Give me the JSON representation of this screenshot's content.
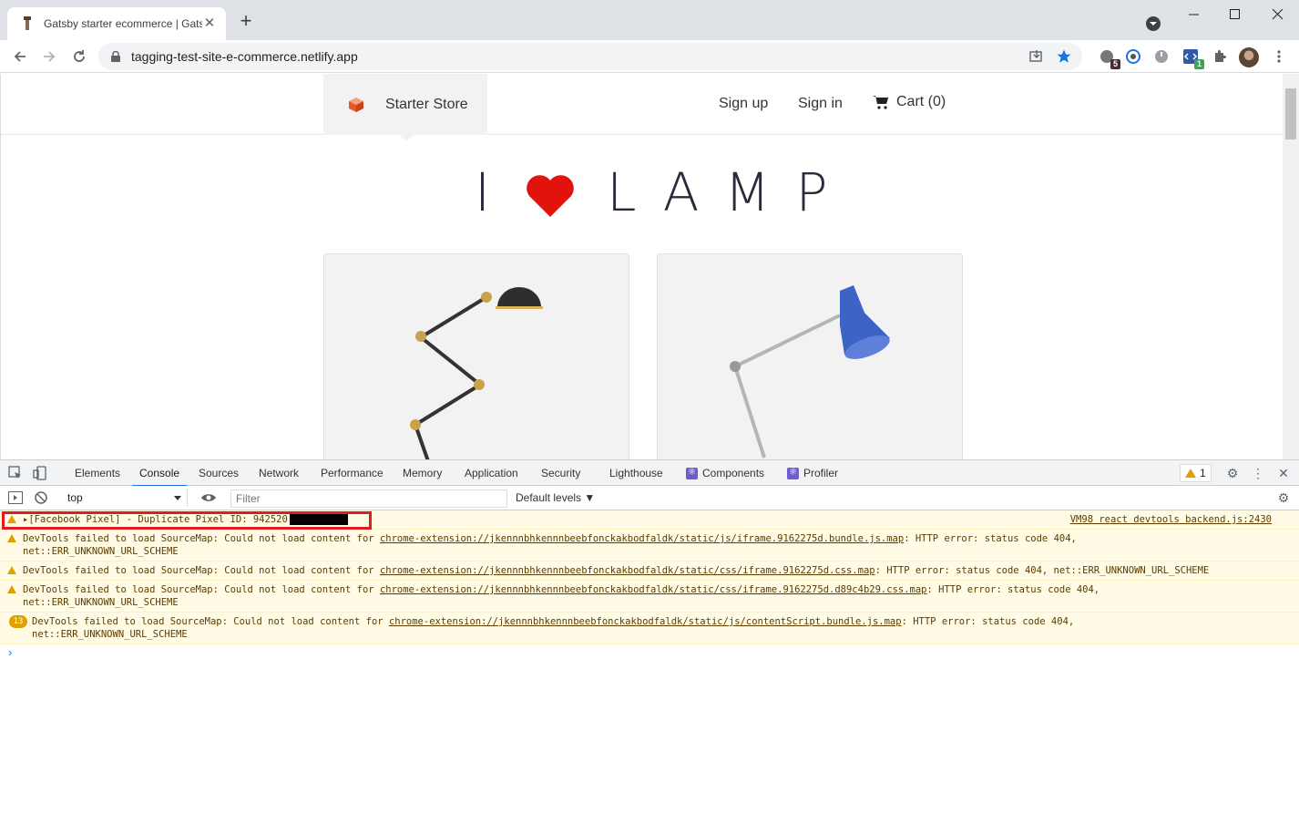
{
  "browser": {
    "tab_title": "Gatsby starter ecommerce | Gatsby",
    "url": "tagging-test-site-e-commerce.netlify.app",
    "extension_badges": [
      "5",
      "1"
    ]
  },
  "site": {
    "brand": "Starter Store",
    "nav": {
      "sign_up": "Sign up",
      "sign_in": "Sign in",
      "cart": "Cart (0)"
    },
    "hero": {
      "left": "I",
      "right": "LAMP"
    }
  },
  "devtools": {
    "tabs": [
      "Elements",
      "Console",
      "Sources",
      "Network",
      "Performance",
      "Memory",
      "Application",
      "Security",
      "Lighthouse",
      "Components",
      "Profiler"
    ],
    "active_tab": "Console",
    "warning_count": "1",
    "context": "top",
    "filter_placeholder": "Filter",
    "levels": "Default levels ▼",
    "messages": [
      {
        "text": "▸[Facebook Pixel] - Duplicate Pixel ID: 942520",
        "source": "VM98 react devtools backend.js:2430"
      },
      {
        "prefix": "DevTools failed to load SourceMap: Could not load content for ",
        "link": "chrome-extension://jkennnbhkennnbeebfonckakbodfaldk/static/js/iframe.9162275d.bundle.js.map",
        "suffix": ": HTTP error: status code 404,",
        "line2": "net::ERR_UNKNOWN_URL_SCHEME"
      },
      {
        "prefix": "DevTools failed to load SourceMap: Could not load content for ",
        "link": "chrome-extension://jkennnbhkennnbeebfonckakbodfaldk/static/css/iframe.9162275d.css.map",
        "suffix": ": HTTP error: status code 404, net::ERR_UNKNOWN_URL_SCHEME"
      },
      {
        "prefix": "DevTools failed to load SourceMap: Could not load content for ",
        "link": "chrome-extension://jkennnbhkennnbeebfonckakbodfaldk/static/css/iframe.9162275d.d89c4b29.css.map",
        "suffix": ": HTTP error: status code 404,",
        "line2": "net::ERR_UNKNOWN_URL_SCHEME"
      },
      {
        "count": "13",
        "prefix": "DevTools failed to load SourceMap: Could not load content for ",
        "link": "chrome-extension://jkennnbhkennnbeebfonckakbodfaldk/static/js/contentScript.bundle.js.map",
        "suffix": ": HTTP error: status code 404,",
        "line2": "net::ERR_UNKNOWN_URL_SCHEME"
      }
    ],
    "prompt": "›"
  },
  "colors": {
    "accent": "#1a73e8",
    "warning_bg": "#fffbe5",
    "warning_icon": "#e0a000",
    "highlight": "#e21b23",
    "heart": "#e0140d"
  }
}
